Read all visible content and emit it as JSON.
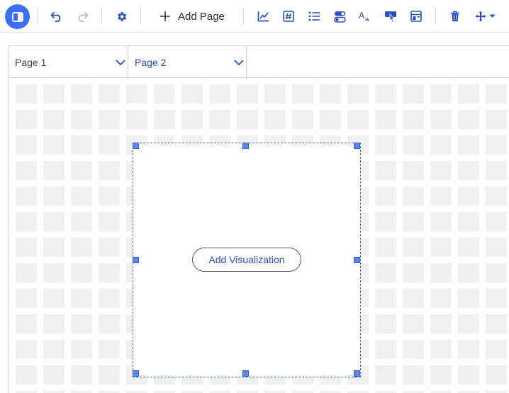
{
  "toolbar": {
    "icons": {
      "panel": "panel-toggle-icon",
      "undo": "undo-icon",
      "redo": "redo-icon",
      "settings": "settings-gear-icon",
      "chart": "line-chart-icon",
      "number": "number-tile-icon",
      "list": "list-icon",
      "toggle": "toggle-control-icon",
      "text": "text-style-icon",
      "interaction": "interaction-pointer-icon",
      "layout": "layout-template-icon",
      "delete": "trash-icon",
      "move": "move-arrows-icon"
    },
    "add_page_label": "Add Page"
  },
  "tabs": [
    {
      "label": "Page 1",
      "selected": false
    },
    {
      "label": "Page 2",
      "selected": true
    }
  ],
  "selection": {
    "button_label": "Add Visualization"
  },
  "colors": {
    "accent": "#3b6ef5",
    "icon_blue": "#2a4fc0",
    "cell_gray": "#f0f0f0",
    "handle": "#5f86f0"
  }
}
